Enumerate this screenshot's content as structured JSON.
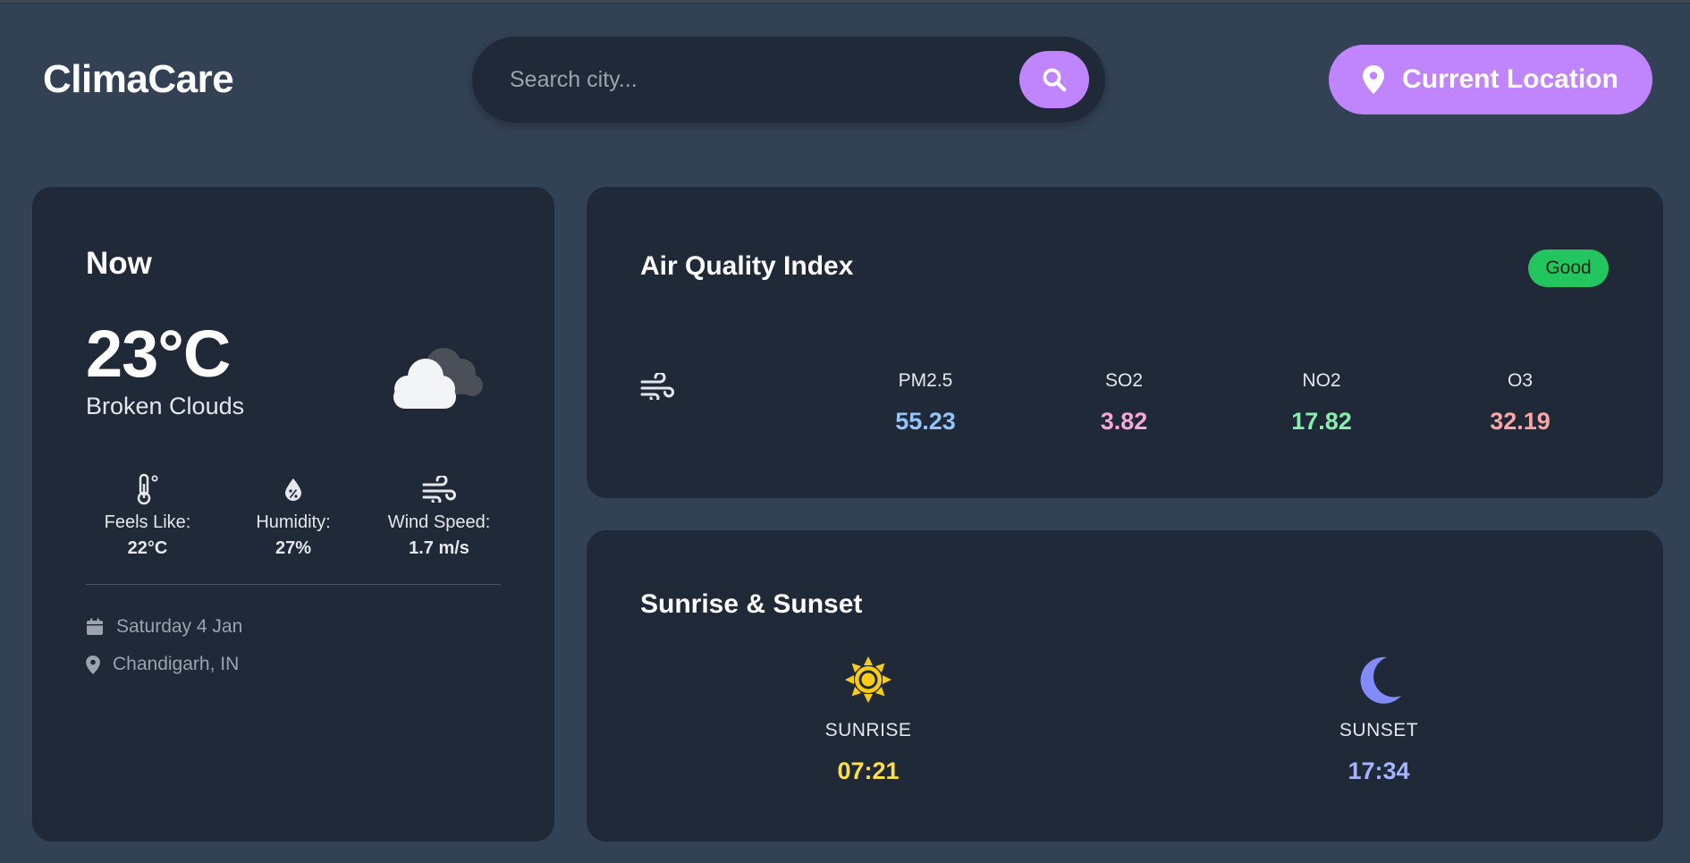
{
  "app": {
    "title": "ClimaCare"
  },
  "search": {
    "placeholder": "Search city..."
  },
  "header": {
    "location_button_label": "Current Location"
  },
  "now": {
    "title": "Now",
    "temperature": "23°C",
    "condition": "Broken Clouds",
    "icon": "broken-clouds-icon",
    "stats": [
      {
        "label": "Feels Like:",
        "value": "22°C",
        "icon": "thermometer-icon"
      },
      {
        "label": "Humidity:",
        "value": "27%",
        "icon": "humidity-drop-icon"
      },
      {
        "label": "Wind Speed:",
        "value": "1.7 m/s",
        "icon": "wind-icon"
      }
    ],
    "date": "Saturday 4 Jan",
    "location": "Chandigarh, IN"
  },
  "aqi": {
    "title": "Air Quality Index",
    "status": "Good",
    "status_color": "#22c55e",
    "items": [
      {
        "label": "PM2.5",
        "value": "55.23",
        "color": "#93c5fd"
      },
      {
        "label": "SO2",
        "value": "3.82",
        "color": "#f9a8d4"
      },
      {
        "label": "NO2",
        "value": "17.82",
        "color": "#86efac"
      },
      {
        "label": "O3",
        "value": "32.19",
        "color": "#fca5a5"
      }
    ]
  },
  "sun": {
    "title": "Sunrise & Sunset",
    "sunrise": {
      "label": "SUNRISE",
      "time": "07:21",
      "color": "#fde047"
    },
    "sunset": {
      "label": "SUNSET",
      "time": "17:34",
      "color": "#a5b4fc"
    }
  },
  "colors": {
    "background": "#334155",
    "card": "#1f2937",
    "accent": "#c084fc"
  }
}
